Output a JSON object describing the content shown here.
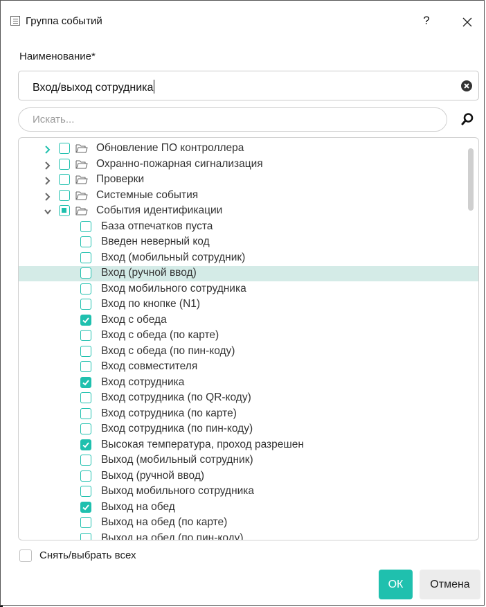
{
  "dialog": {
    "title": "Группа событий",
    "help_label": "?",
    "icons": {
      "title": "list-icon",
      "close": "close-icon"
    }
  },
  "form": {
    "name_label": "Наименование*",
    "name_value": "Вход/выход сотрудника",
    "search_placeholder": "Искать..."
  },
  "colors": {
    "accent": "#1fc0ae",
    "highlight": "#d4ebe7",
    "cancel_bg": "#ececec"
  },
  "tree": {
    "groups": [
      {
        "label": "Обновление ПО контроллера",
        "expanded": false,
        "state": "unchecked",
        "chevron_color": "#1fc0ae"
      },
      {
        "label": "Охранно-пожарная сигнализация",
        "expanded": false,
        "state": "unchecked"
      },
      {
        "label": "Проверки",
        "expanded": false,
        "state": "unchecked"
      },
      {
        "label": "Системные события",
        "expanded": false,
        "state": "unchecked"
      },
      {
        "label": "События идентификации",
        "expanded": true,
        "state": "partial"
      }
    ],
    "items": [
      {
        "label": "База отпечатков пуста",
        "checked": false
      },
      {
        "label": "Введен неверный код",
        "checked": false
      },
      {
        "label": "Вход (мобильный сотрудник)",
        "checked": false
      },
      {
        "label": "Вход (ручной ввод)",
        "checked": false,
        "highlighted": true
      },
      {
        "label": "Вход мобильного сотрудника",
        "checked": false
      },
      {
        "label": "Вход по кнопке (N1)",
        "checked": false
      },
      {
        "label": "Вход с обеда",
        "checked": true
      },
      {
        "label": "Вход с обеда (по карте)",
        "checked": false
      },
      {
        "label": "Вход с обеда (по пин-коду)",
        "checked": false
      },
      {
        "label": "Вход совместителя",
        "checked": false
      },
      {
        "label": "Вход сотрудника",
        "checked": true
      },
      {
        "label": "Вход сотрудника (по QR-коду)",
        "checked": false
      },
      {
        "label": "Вход сотрудника (по карте)",
        "checked": false
      },
      {
        "label": "Вход сотрудника (по пин-коду)",
        "checked": false
      },
      {
        "label": "Высокая температура, проход разрешен",
        "checked": true
      },
      {
        "label": "Выход (мобильный сотрудник)",
        "checked": false
      },
      {
        "label": "Выход (ручной ввод)",
        "checked": false
      },
      {
        "label": "Выход мобильного сотрудника",
        "checked": false
      },
      {
        "label": "Выход на обед",
        "checked": true
      },
      {
        "label": "Выход на обед (по карте)",
        "checked": false
      },
      {
        "label": "Выход на обед (по пин-коду)",
        "checked": false
      }
    ]
  },
  "footer": {
    "select_all_label": "Снять/выбрать всех",
    "ok_label": "ОК",
    "cancel_label": "Отмена"
  }
}
